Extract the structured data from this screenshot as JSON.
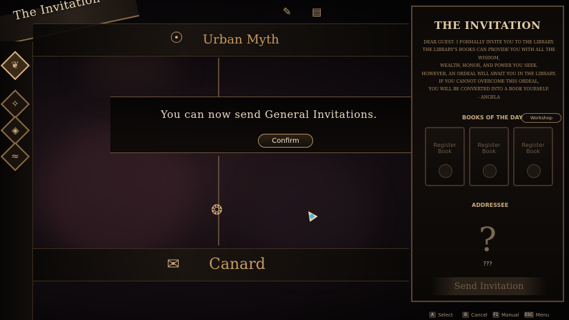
{
  "header": {
    "title": "The Invitation",
    "top_icons": [
      "speech-bubble-icon",
      "book-icon"
    ]
  },
  "side_nav": [
    {
      "name": "tree-icon",
      "glyph": "❦",
      "active": true
    },
    {
      "name": "hexagon-icon",
      "glyph": "✧",
      "active": false
    },
    {
      "name": "cube-icon",
      "glyph": "◈",
      "active": false
    },
    {
      "name": "wave-icon",
      "glyph": "≈",
      "active": false
    }
  ],
  "categories": [
    {
      "label": "Urban Myth",
      "icon": "mask-icon",
      "glyph": "☉"
    },
    {
      "label": "Canard",
      "icon": "speech-icon",
      "glyph": "✉"
    }
  ],
  "modal": {
    "message": "You can now send General Invitations.",
    "confirm_label": "Confirm"
  },
  "panel": {
    "title": "THE INVITATION",
    "letter_lines": [
      "DEAR GUEST: I FORMALLY INVITE YOU TO THE LIBRARY.",
      "THE LIBRARY'S BOOKS CAN PROVIDE YOU WITH ALL THE",
      "WISDOM,",
      "WEALTH, HONOR, AND POWER YOU SEEK.",
      "HOWEVER, AN ORDEAL WILL AWAIT YOU IN THE LIBRARY.",
      "IF YOU CANNOT OVERCOME THIS ORDEAL,",
      "YOU WILL BE CONVERTED INTO A BOOK YOURSELF.",
      "- ANGELA"
    ],
    "books_title": "BOOKS OF THE DAY",
    "workshop_label": "Workshop",
    "book_slots": [
      "Register Book",
      "Register Book",
      "Register Book"
    ],
    "addressee_title": "ADDRESSEE",
    "addressee_mark": "?",
    "addressee_name": "???",
    "send_label": "Send Invitation"
  },
  "hints": [
    {
      "key": "A",
      "label": "Select"
    },
    {
      "key": "B",
      "label": "Cancel"
    },
    {
      "key": "F1",
      "label": "Manual"
    },
    {
      "key": "ESC",
      "label": "Menu"
    }
  ],
  "colors": {
    "accent": "#c59b62",
    "panel_border": "#5a4431",
    "text_light": "#e6d9c5"
  }
}
